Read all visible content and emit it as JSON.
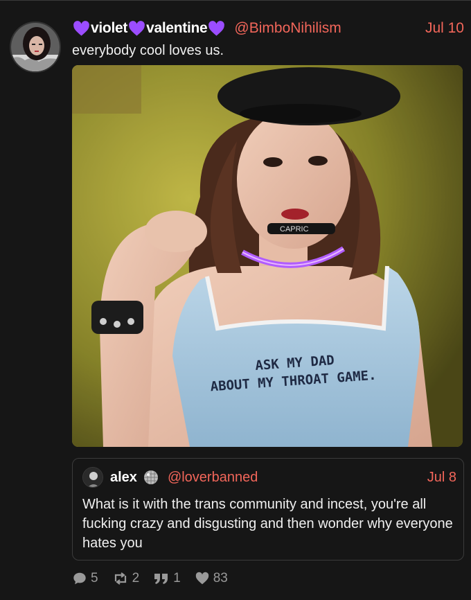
{
  "post": {
    "display_name_parts": [
      "violet",
      "valentine"
    ],
    "heart_icon": "purple-heart-icon",
    "heart_color": "#9b4dff",
    "handle": "@BimboNihilism",
    "date": "Jul 10",
    "text": "everybody cool loves us.",
    "image_shirt_text_line1": "ASK MY DAD",
    "image_shirt_text_line2": "ABOUT MY THROAT GAME.",
    "image_collar_text": "CAPRIC"
  },
  "quote": {
    "name": "alex",
    "badge_icon": "disco-ball-icon",
    "handle": "@loverbanned",
    "date": "Jul 8",
    "text": "What is it with the trans community and incest, you're all fucking crazy and disgusting and then wonder why everyone hates you"
  },
  "actions": {
    "replies": "5",
    "reposts": "2",
    "quotes": "1",
    "likes": "83"
  },
  "colors": {
    "background": "#161616",
    "accent": "#f2665a",
    "muted": "#9a9a9a"
  }
}
